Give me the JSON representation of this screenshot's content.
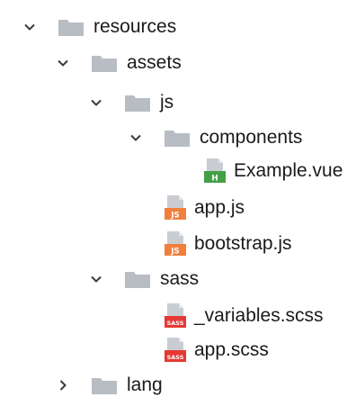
{
  "tree": {
    "items": [
      {
        "label": "resources",
        "kind": "folder",
        "state": "expanded",
        "level": 0
      },
      {
        "label": "assets",
        "kind": "folder",
        "state": "expanded",
        "level": 1
      },
      {
        "label": "js",
        "kind": "folder",
        "state": "expanded",
        "level": 2
      },
      {
        "label": "components",
        "kind": "folder",
        "state": "expanded",
        "level": 3
      },
      {
        "label": "Example.vue",
        "kind": "file",
        "icon": "vue-file-icon",
        "badge": "H",
        "badge_color": "#43a047",
        "level": 4
      },
      {
        "label": "app.js",
        "kind": "file",
        "icon": "js-file-icon",
        "badge": "JS",
        "badge_color": "#f07f3c",
        "level": 3
      },
      {
        "label": "bootstrap.js",
        "kind": "file",
        "icon": "js-file-icon",
        "badge": "JS",
        "badge_color": "#f07f3c",
        "level": 3
      },
      {
        "label": "sass",
        "kind": "folder",
        "state": "expanded",
        "level": 2
      },
      {
        "label": "_variables.scss",
        "kind": "file",
        "icon": "sass-file-icon",
        "badge": "SASS",
        "badge_color": "#e53935",
        "level": 3
      },
      {
        "label": "app.scss",
        "kind": "file",
        "icon": "sass-file-icon",
        "badge": "SASS",
        "badge_color": "#e53935",
        "level": 3
      },
      {
        "label": "lang",
        "kind": "folder",
        "state": "collapsed",
        "level": 1
      }
    ]
  },
  "colors": {
    "folder": "#b8bcc3",
    "chevron": "#3a3a3a",
    "text": "#1a1a1a",
    "file_body": "#c9cdd2"
  }
}
